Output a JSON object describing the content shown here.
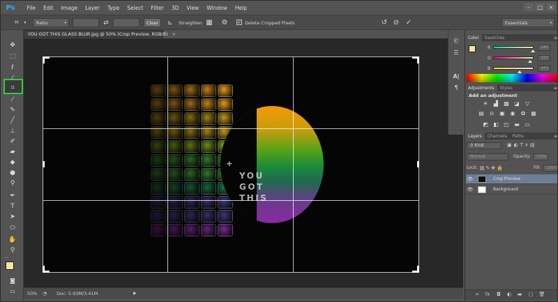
{
  "app": {
    "logo": "Ps",
    "accent": "#31a8ff"
  },
  "menu": [
    "File",
    "Edit",
    "Image",
    "Layer",
    "Type",
    "Select",
    "Filter",
    "3D",
    "View",
    "Window",
    "Help"
  ],
  "window_controls": {
    "minimize": "–",
    "restore": "□",
    "close": "×"
  },
  "options_bar": {
    "ratio_preset": "Ratio",
    "width_value": "",
    "swap_icon": "swap-icon",
    "height_value": "",
    "clear_label": "Clear",
    "straighten_label": "Straighten",
    "delete_cropped_label": "Delete Cropped Pixels",
    "delete_cropped_checked": true,
    "workspace": "Essentials"
  },
  "document": {
    "tab_title": "YOU GOT THIS GLASS BLUR.jpg @ 50% (Crop Preview, RGB/8)",
    "slogan": [
      "YOU",
      "GOT",
      "THIS"
    ]
  },
  "statusbar": {
    "zoom": "50%",
    "doc_info": "Doc: 5.93M/3.41M"
  },
  "panels": {
    "color": {
      "tabs": [
        "Color",
        "Swatches"
      ],
      "foreground": "#f5e3a3",
      "background": "#ffffff",
      "sliders": [
        {
          "letter": "R",
          "value": "245",
          "level": 0.96
        },
        {
          "letter": "G",
          "value": "227",
          "level": 0.89
        },
        {
          "letter": "B",
          "value": "163",
          "level": 0.64
        }
      ]
    },
    "adjustments": {
      "tabs": [
        "Adjustments",
        "Styles"
      ],
      "title": "Add an adjustment"
    },
    "layers": {
      "tabs": [
        "Layers",
        "Channels",
        "Paths"
      ],
      "filter_kind": "Kind",
      "blend_mode": "Normal",
      "opacity_label": "Opacity:",
      "opacity_value": "100%",
      "lock_label": "Lock:",
      "fill_label": "Fill:",
      "fill_value": "100%",
      "items": [
        {
          "name": "Crop Preview",
          "selected": true
        },
        {
          "name": "Background",
          "selected": false
        }
      ]
    }
  }
}
